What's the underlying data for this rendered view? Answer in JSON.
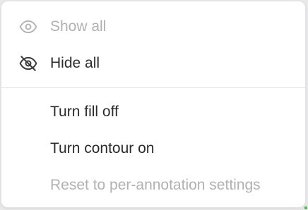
{
  "menu": {
    "items": [
      {
        "label": "Show all",
        "icon": "eye-icon",
        "enabled": false
      },
      {
        "label": "Hide all",
        "icon": "eye-off-icon",
        "enabled": true
      },
      {
        "label": "Turn fill off",
        "icon": "",
        "enabled": true
      },
      {
        "label": "Turn contour on",
        "icon": "",
        "enabled": true
      },
      {
        "label": "Reset to per-annotation settings",
        "icon": "",
        "enabled": false
      }
    ]
  },
  "colors": {
    "enabled_text": "#2b2b2b",
    "disabled_text": "#b1b1b1",
    "divider": "#e6e6e6",
    "background": "#ffffff"
  }
}
